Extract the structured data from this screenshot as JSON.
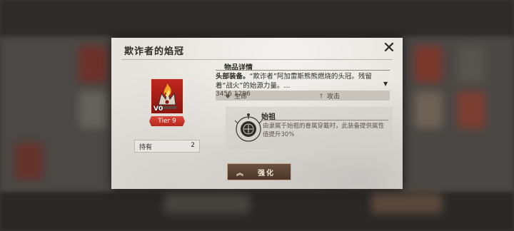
{
  "dialog": {
    "title": "欺诈者的焰冠",
    "close_icon": "close-icon"
  },
  "item": {
    "level": "V0",
    "tier": "Tier 9",
    "own_label": "持有",
    "own_value": "2",
    "icon": "crown-flame-icon"
  },
  "details": {
    "section_title": "物品详情",
    "desc_bold": "头部装备。",
    "desc_text": "“欺诈者”阿加雷斯熊熊燃烧的头冠。残留着“战火”的始源力量。...",
    "scroll_indicator": "▼"
  },
  "stats": [
    {
      "icon": "diamond-icon",
      "label": "生命",
      "value": "3456"
    },
    {
      "icon": "sword-icon",
      "label": "攻击",
      "value": "1296"
    }
  ],
  "effect": {
    "name": "始祖",
    "description": "由隶属于始祖的眷属穿戴时，此装备提供属性值提升30%",
    "icon": "ancestor-emblem-icon"
  },
  "upgrade_button": {
    "label": "强化",
    "icon": "double-chevron-up-icon"
  },
  "colors": {
    "tier_red": "#c83328",
    "button_brown": "#5a4334",
    "panel_bg": "#e7e4de"
  }
}
